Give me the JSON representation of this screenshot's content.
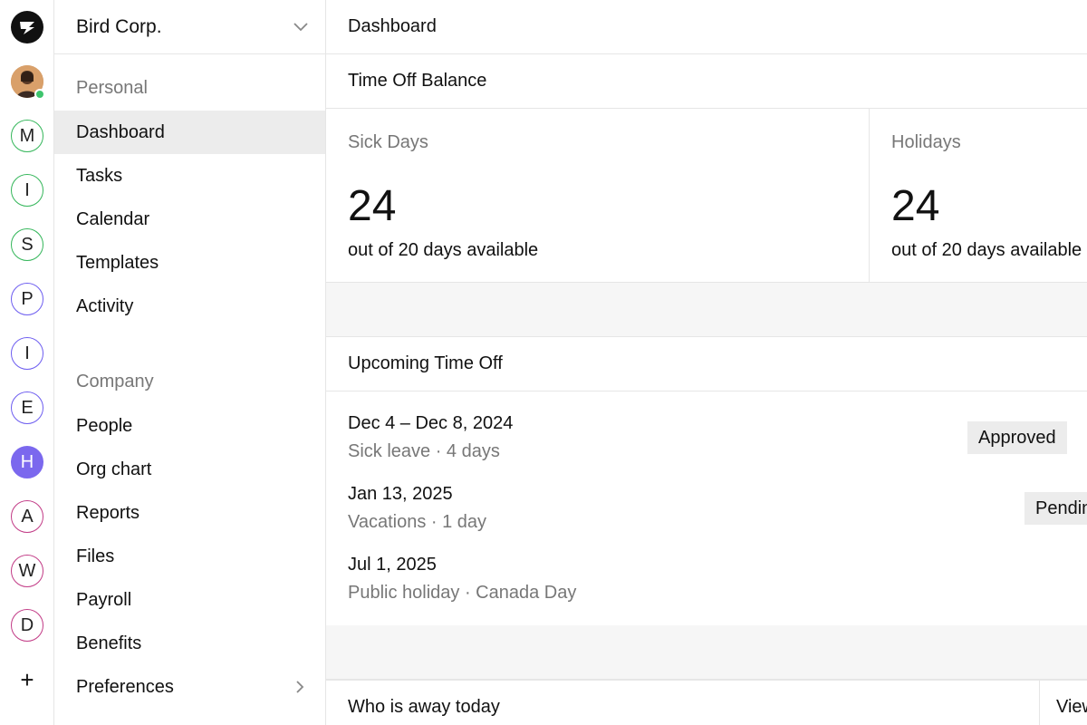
{
  "rail": {
    "workspaces": [
      {
        "letter": "M",
        "style": "green"
      },
      {
        "letter": "I",
        "style": "green"
      },
      {
        "letter": "S",
        "style": "green"
      },
      {
        "letter": "P",
        "style": "purple"
      },
      {
        "letter": "I",
        "style": "purple"
      },
      {
        "letter": "E",
        "style": "purple"
      },
      {
        "letter": "H",
        "style": "filled"
      },
      {
        "letter": "A",
        "style": "pink"
      },
      {
        "letter": "W",
        "style": "pink"
      },
      {
        "letter": "D",
        "style": "pink"
      }
    ],
    "add_label": "+",
    "colors": {
      "green": "#34b65a",
      "purple": "#6d5df0",
      "filled": "#7b68ee",
      "pink": "#c23b86",
      "presence": "#3ec46d"
    }
  },
  "sidebar": {
    "org_name": "Bird Corp.",
    "personal_title": "Personal",
    "personal_items": [
      "Dashboard",
      "Tasks",
      "Calendar",
      "Templates",
      "Activity"
    ],
    "company_title": "Company",
    "company_items": [
      "People",
      "Org chart",
      "Reports",
      "Files",
      "Payroll",
      "Benefits",
      "Preferences"
    ]
  },
  "main": {
    "page_title": "Dashboard",
    "balance_title": "Time Off Balance",
    "sick": {
      "label": "Sick Days",
      "value": "24",
      "sub": "out of 20 days available"
    },
    "holidays": {
      "label": "Holidays",
      "value": "24",
      "sub": "out of 20 days available"
    },
    "upcoming_title": "Upcoming Time Off",
    "upcoming": [
      {
        "date": "Dec 4 – Dec 8, 2024",
        "detail": "Sick leave · 4 days",
        "status": "Approved"
      },
      {
        "date": "Jan 13, 2025",
        "detail": "Vacations · 1 day",
        "status": "Pending"
      },
      {
        "date": "Jul 1, 2025",
        "detail": "Public holiday · Canada Day",
        "status": ""
      }
    ],
    "away_title": "Who is away today",
    "view_label": "View all"
  }
}
